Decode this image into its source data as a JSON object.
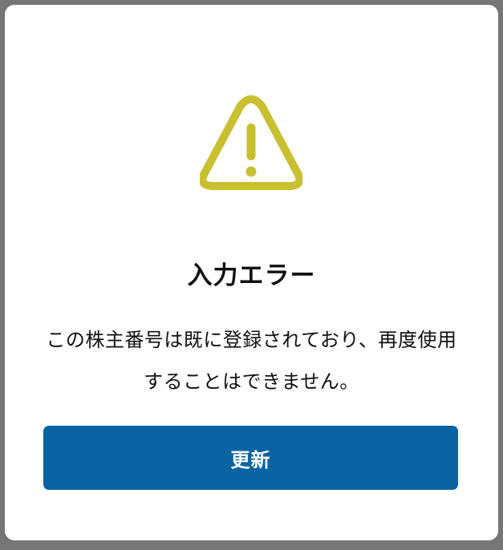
{
  "dialog": {
    "icon": "warning-triangle-icon",
    "icon_color": "#c9c031",
    "title": "入力エラー",
    "message": "この株主番号は既に登録されており、再度使用することはできません。",
    "button_label": "更新",
    "button_color": "#0a64a4"
  }
}
